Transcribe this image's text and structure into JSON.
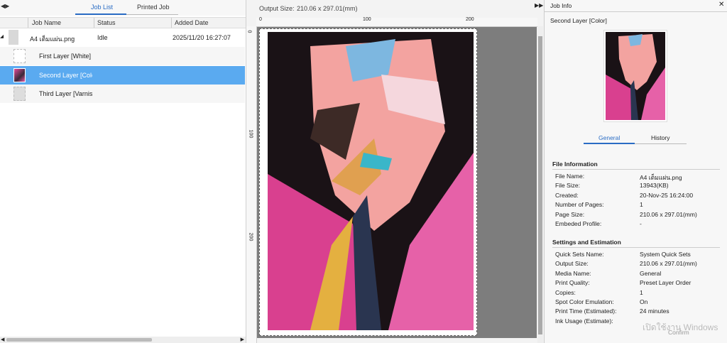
{
  "job_list": {
    "tabs": [
      "Job List",
      "Printed Job"
    ],
    "columns": [
      "Job Name",
      "Status",
      "Added Date"
    ],
    "job": {
      "name": "A4 เต็มแผ่น.png",
      "status": "Idle",
      "added": "2025/11/20 16:27:07"
    },
    "layers": [
      "First Layer [White]",
      "Second Layer [Color]",
      "Third Layer [Varnish]"
    ]
  },
  "preview": {
    "output_size_label": "Output Size:",
    "output_size_value": "210.06 x 297.01(mm)",
    "ruler_h": [
      "0",
      "100",
      "200"
    ],
    "ruler_v": [
      "0",
      "100",
      "200"
    ]
  },
  "job_info": {
    "title": "Job Info",
    "layer_name": "Second Layer [Color]",
    "tabs": [
      "General",
      "History"
    ],
    "file_info_heading": "File Information",
    "file_info": [
      {
        "k": "File Name:",
        "v": "A4 เต็มแผ่น.png"
      },
      {
        "k": "File Size:",
        "v": "13943(KB)"
      },
      {
        "k": "Created:",
        "v": "20-Nov-25 16:24:00"
      },
      {
        "k": "Number of Pages:",
        "v": "1"
      },
      {
        "k": "Page Size:",
        "v": "210.06 x 297.01(mm)"
      },
      {
        "k": "Embeded Profile:",
        "v": "-"
      }
    ],
    "settings_heading": "Settings and Estimation",
    "settings": [
      {
        "k": "Quick Sets Name:",
        "v": "System Quick Sets"
      },
      {
        "k": "Output Size:",
        "v": "210.06 x 297.01(mm)"
      },
      {
        "k": "Media Name:",
        "v": "General"
      },
      {
        "k": "Print Quality:",
        "v": "Preset Layer Order"
      },
      {
        "k": "Copies:",
        "v": "1"
      },
      {
        "k": "Spot Color Emulation:",
        "v": "On"
      },
      {
        "k": "Print Time (Estimated):",
        "v": "24 minutes"
      },
      {
        "k": "Ink Usage (Estimate):",
        "v": ""
      }
    ],
    "confirm_label": "Confirm",
    "watermark": "เปิดใช้งาน Windows"
  },
  "colors": {
    "accent": "#2a6cc4",
    "selection": "#5aaaf0"
  }
}
